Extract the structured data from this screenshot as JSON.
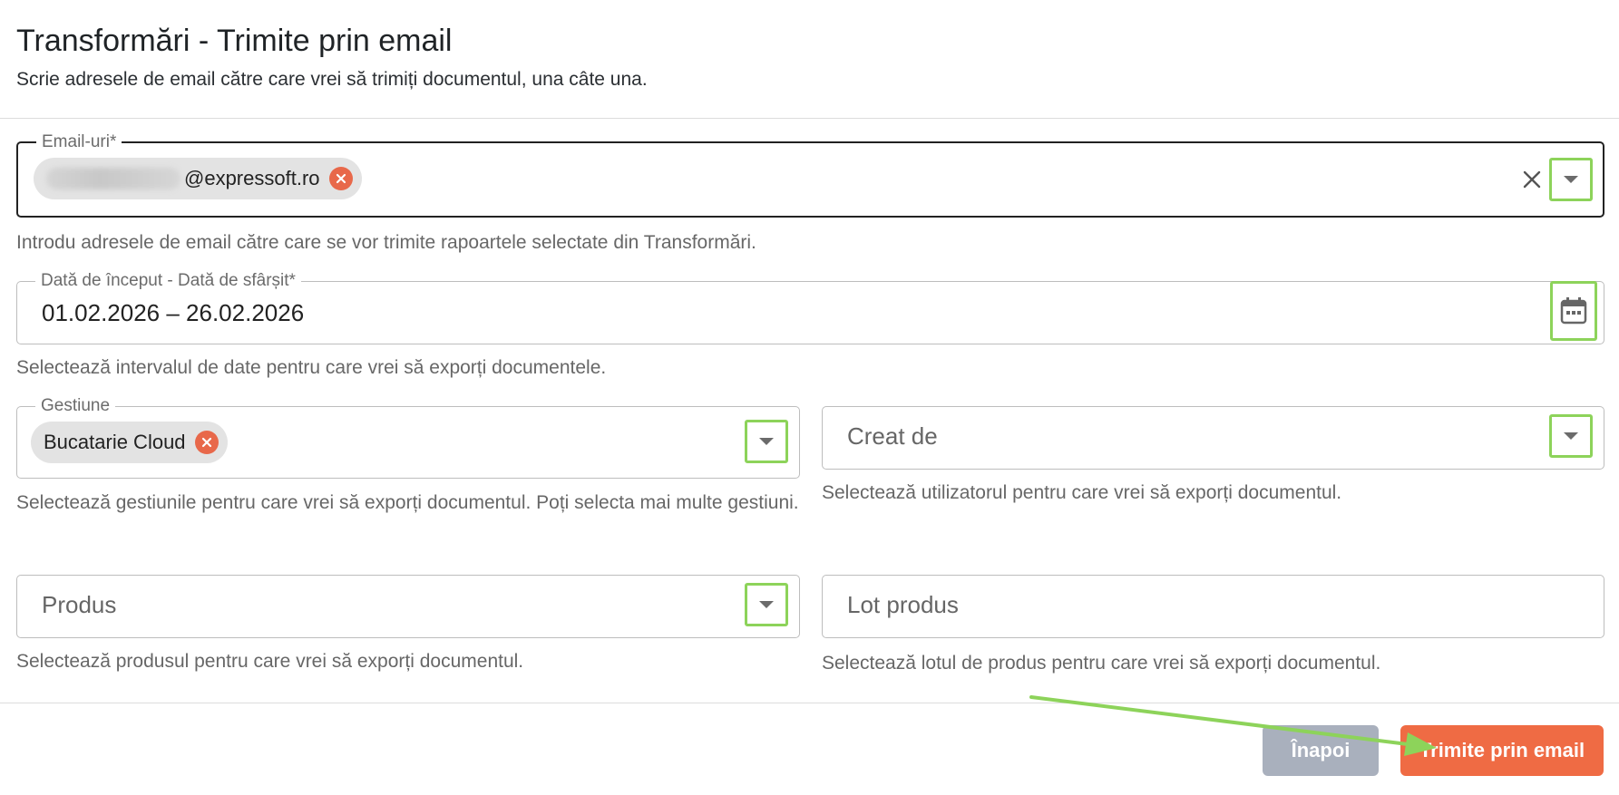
{
  "dialog": {
    "title": "Transformări - Trimite prin email",
    "subtitle": "Scrie adresele de email către care vrei să trimiți documentul, una câte una."
  },
  "emails_field": {
    "label": "Email-uri",
    "required_mark": "*",
    "chip_text": "@expressoft.ro",
    "helper": "Introdu adresele de email către care se vor trimite rapoartele selectate din Transformări."
  },
  "date_field": {
    "label": "Dată de început - Dată de sfârșit",
    "required_mark": "*",
    "value": "01.02.2026 – 26.02.2026",
    "helper": "Selectează intervalul de date pentru care vrei să exporți documentele."
  },
  "gestiune_field": {
    "label": "Gestiune",
    "chip_text": "Bucatarie Cloud",
    "helper": "Selectează gestiunile pentru care vrei să exporți documentul. Poți selecta mai multe gestiuni."
  },
  "creat_de_field": {
    "placeholder": "Creat de",
    "helper": "Selectează utilizatorul pentru care vrei să exporți documentul."
  },
  "produs_field": {
    "placeholder": "Produs",
    "helper": "Selectează produsul pentru care vrei să exporți documentul."
  },
  "lot_field": {
    "placeholder": "Lot produs",
    "helper": "Selectează lotul de produs pentru care vrei să exporți documentul."
  },
  "actions": {
    "back_label": "Înapoi",
    "send_label": "Trimite prin email"
  },
  "colors": {
    "accent": "#ef6b44",
    "secondary_button": "#a9b0bd",
    "chip_remove": "#e8684a",
    "highlight": "#8dd35a"
  }
}
